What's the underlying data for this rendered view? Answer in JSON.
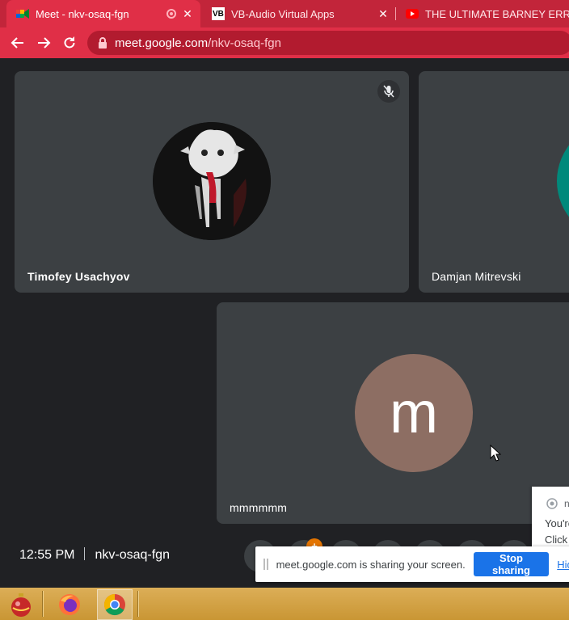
{
  "browser": {
    "tabs": [
      {
        "title": "Meet - nkv-osaq-fgn",
        "favicon": "google-meet-icon",
        "active": true,
        "recording": true
      },
      {
        "title": "VB-Audio Virtual Apps",
        "favicon": "vb-audio-icon",
        "active": false
      },
      {
        "title": "THE ULTIMATE BARNEY ERROR -",
        "favicon": "youtube-icon",
        "active": false
      }
    ],
    "close_glyph": "✕",
    "url_host": "meet.google.com",
    "url_path": "/nkv-osaq-fgn"
  },
  "meet": {
    "participants": [
      {
        "name": "Timofey Usachyov",
        "muted": true,
        "avatar": "profile-photo"
      },
      {
        "name": "Damjan Mitrevski",
        "avatar": "teal-initial"
      },
      {
        "name": "mmmmmm",
        "avatar_letter": "m",
        "avatar_color": "#8d6e63"
      }
    ],
    "time": "12:55 PM",
    "meeting_code": "nkv-osaq-fgn",
    "badge_count": "+"
  },
  "sharing_bar": {
    "message": "meet.google.com is sharing your screen.",
    "stop_label": "Stop sharing",
    "hide_label": "Hide"
  },
  "notification": {
    "title": "n",
    "line1": "You're",
    "line2": "Click"
  },
  "taskbar": {
    "items": [
      "ornament-icon",
      "firefox-icon",
      "chrome-icon"
    ]
  },
  "colors": {
    "tabstrip": "#c2253a",
    "toolbar": "#e02f47",
    "meet_bg": "#202124",
    "tile": "#3c4043",
    "accent": "#1a73e8"
  }
}
